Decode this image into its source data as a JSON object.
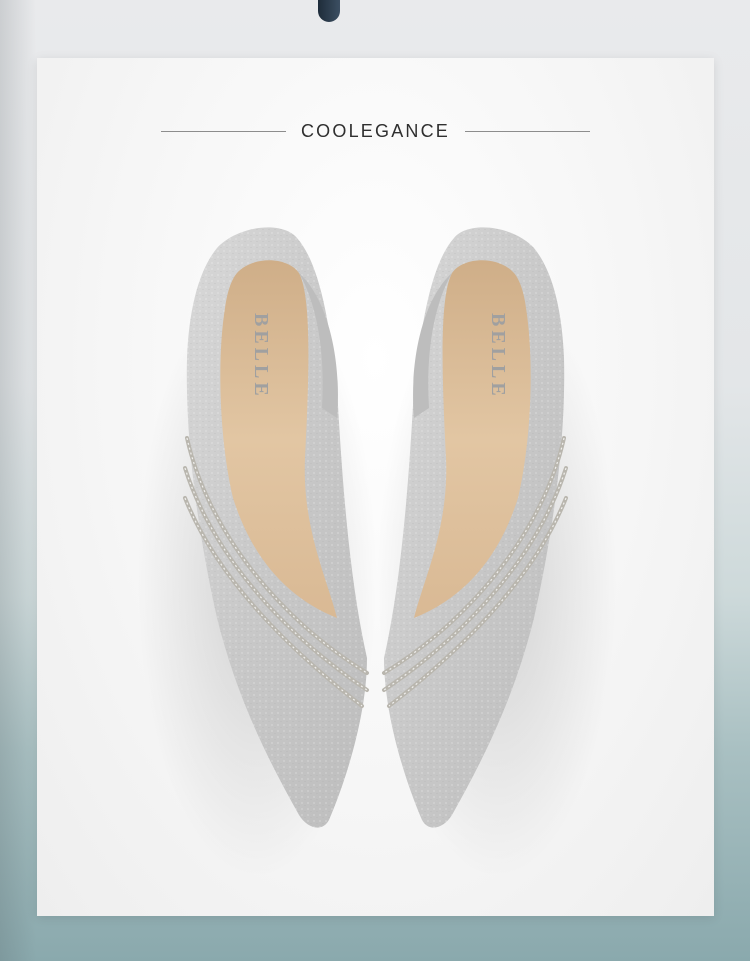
{
  "heading": {
    "title": "COOLEGANCE"
  },
  "shoes": {
    "brand_insole_text": "BELLE",
    "upper_color": "#c9c9c9",
    "lining_color": "#dcc09e",
    "strap_color": "#b9b6ae"
  }
}
